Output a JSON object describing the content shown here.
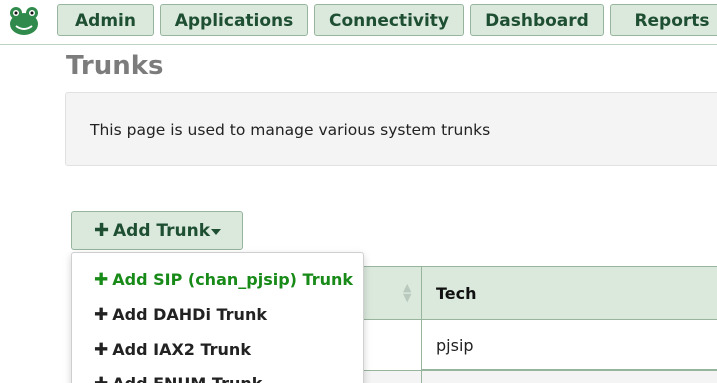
{
  "nav": {
    "admin": "Admin",
    "applications": "Applications",
    "connectivity": "Connectivity",
    "dashboard": "Dashboard",
    "reports": "Reports"
  },
  "page": {
    "title": "Trunks",
    "description": "This page is used to manage various system trunks"
  },
  "add_trunk": {
    "label": "Add Trunk",
    "icon": "plus-icon",
    "menu": [
      "Add SIP (chan_pjsip) Trunk",
      "Add DAHDi Trunk",
      "Add IAX2 Trunk",
      "Add ENUM Trunk"
    ]
  },
  "table": {
    "headers": {
      "tech": "Tech"
    },
    "rows": [
      {
        "tech": "pjsip"
      }
    ]
  },
  "colors": {
    "nav_bg": "#dbe9dd",
    "nav_text": "#1e4f33",
    "highlight_item": "#188a18"
  }
}
